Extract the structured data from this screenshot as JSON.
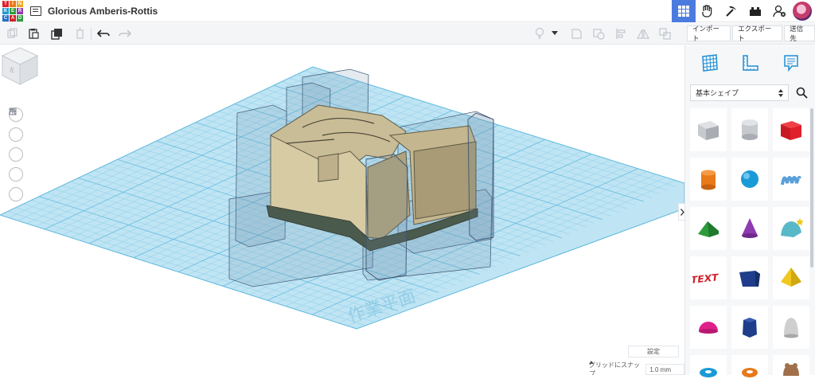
{
  "app": {
    "logo_letters": [
      "TIN",
      "KER",
      "CAD"
    ],
    "design_title": "Glorious Amberis-Rottis"
  },
  "topbar": {
    "icons": [
      "grid-view-icon",
      "hand-icon",
      "pickaxe-icon",
      "brick-icon",
      "add-user-icon",
      "avatar"
    ]
  },
  "toolbar": {
    "left_icons": [
      "copy-icon",
      "paste-icon",
      "duplicate-icon",
      "delete-icon",
      "undo-icon",
      "redo-icon"
    ],
    "right_icons": [
      "light-bulb-icon",
      "dropdown-arrow-icon",
      "note-icon",
      "shape-outline-icon",
      "align-icon",
      "mirror-icon",
      "group-icon"
    ]
  },
  "actions": {
    "import": "インポート",
    "export": "エクスポート",
    "send": "送信先"
  },
  "panel": {
    "view_icons": [
      "workplane-grid-icon",
      "ruler-icon",
      "notes-icon"
    ],
    "category": "基本シェイプ",
    "shapes": [
      {
        "name": "box-striped",
        "color": "#b8bcc3"
      },
      {
        "name": "cylinder-striped",
        "color": "#c4c7cc"
      },
      {
        "name": "box",
        "color": "#e0202a"
      },
      {
        "name": "cylinder",
        "color": "#e87a1a"
      },
      {
        "name": "sphere",
        "color": "#1a9ad6"
      },
      {
        "name": "scribble",
        "color": "#5aa0d8"
      },
      {
        "name": "roof",
        "color": "#2e9b3c"
      },
      {
        "name": "cone",
        "color": "#8e3bb0"
      },
      {
        "name": "round-roof",
        "color": "#59b8c8"
      },
      {
        "name": "text",
        "color": "#d0202a"
      },
      {
        "name": "wedge",
        "color": "#1f3d8a"
      },
      {
        "name": "pyramid",
        "color": "#f0c820"
      },
      {
        "name": "half-sphere",
        "color": "#e0208a"
      },
      {
        "name": "polygon",
        "color": "#1f3d8a"
      },
      {
        "name": "paraboloid",
        "color": "#c8c8c8"
      }
    ]
  },
  "viewport": {
    "workplane_label": "作業平面",
    "settings_label": "設定",
    "snap_label": "グリッドにスナップ",
    "snap_value": "1.0 mm"
  }
}
